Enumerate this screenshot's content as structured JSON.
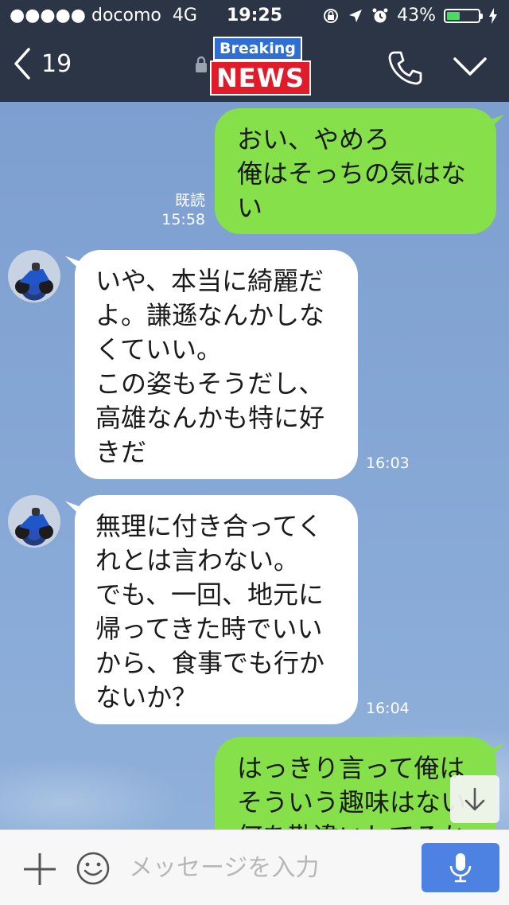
{
  "status_bar": {
    "carrier": "●●●●● docomo",
    "network": "4G",
    "time": "19:25",
    "battery_percent": "43%",
    "battery_level": 0.43
  },
  "nav": {
    "back_count": "19",
    "logo_breaking": "Breaking",
    "logo_news": "NEWS"
  },
  "messages": [
    {
      "direction": "out",
      "text": "おい、やめろ\n俺はそっちの気はな\nい",
      "read_label": "既読",
      "time": "15:58"
    },
    {
      "direction": "in",
      "text": "いや、本当に綺麗だ\nよ。謙遜なんかしな\nくていい。\nこの姿もそうだし、\n高雄なんかも特に好\nきだ",
      "time": "16:03"
    },
    {
      "direction": "in",
      "text": "無理に付き合ってく\nれとは言わない。\nでも、一回、地元に\n帰ってきた時でいい\nから、食事でも行か\nないか？",
      "time": "16:04"
    },
    {
      "direction": "out",
      "text": "はっきり言って俺は\nそういう趣味はない\n何を勘違いしてるか",
      "read_label": "",
      "time": ""
    }
  ],
  "input": {
    "placeholder": "メッセージを入力"
  },
  "colors": {
    "header_bg": "#2b3546",
    "outgoing_bubble": "#85e049",
    "incoming_bubble": "#ffffff",
    "mic_button": "#4d82e2"
  }
}
